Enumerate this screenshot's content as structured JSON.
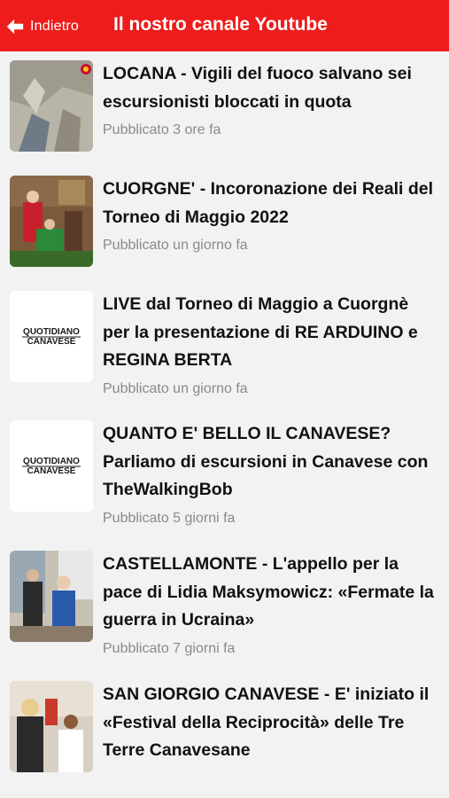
{
  "header": {
    "back_label": "Indietro",
    "title": "Il nostro canale Youtube",
    "background_color": "#ee1c1c"
  },
  "items": [
    {
      "headline": "LOCANA - Vigili del fuoco salvano sei escursionisti bloccati in quota",
      "published": "Pubblicato 3 ore fa",
      "thumb": "rescue-photo"
    },
    {
      "headline": "CUORGNE' - Incoronazione dei Reali del Torneo di Maggio 2022",
      "published": "Pubblicato un giorno fa",
      "thumb": "ceremony-photo"
    },
    {
      "headline": "LIVE dal Torneo di Maggio a Cuorgnè per la presentazione di RE ARDUINO e REGINA BERTA",
      "published": "Pubblicato un giorno fa",
      "thumb": "logo",
      "logo_line1": "QUOTIDIANO",
      "logo_line2": "CANAVESE"
    },
    {
      "headline": "QUANTO E' BELLO IL CANAVESE? Parliamo di escursioni in Canavese con TheWalkingBob",
      "published": "Pubblicato 5 giorni fa",
      "thumb": "logo",
      "logo_line1": "QUOTIDIANO",
      "logo_line2": "CANAVESE"
    },
    {
      "headline": "CASTELLAMONTE - L'appello per la pace di Lidia Maksymowicz: «Fermate la guerra in Ucraina»",
      "published": "Pubblicato 7 giorni fa",
      "thumb": "people-photo"
    },
    {
      "headline": "SAN GIORGIO CANAVESE - E' iniziato il «Festival della Reciprocità» delle Tre Terre Canavesane",
      "published": "",
      "thumb": "festival-photo"
    }
  ]
}
